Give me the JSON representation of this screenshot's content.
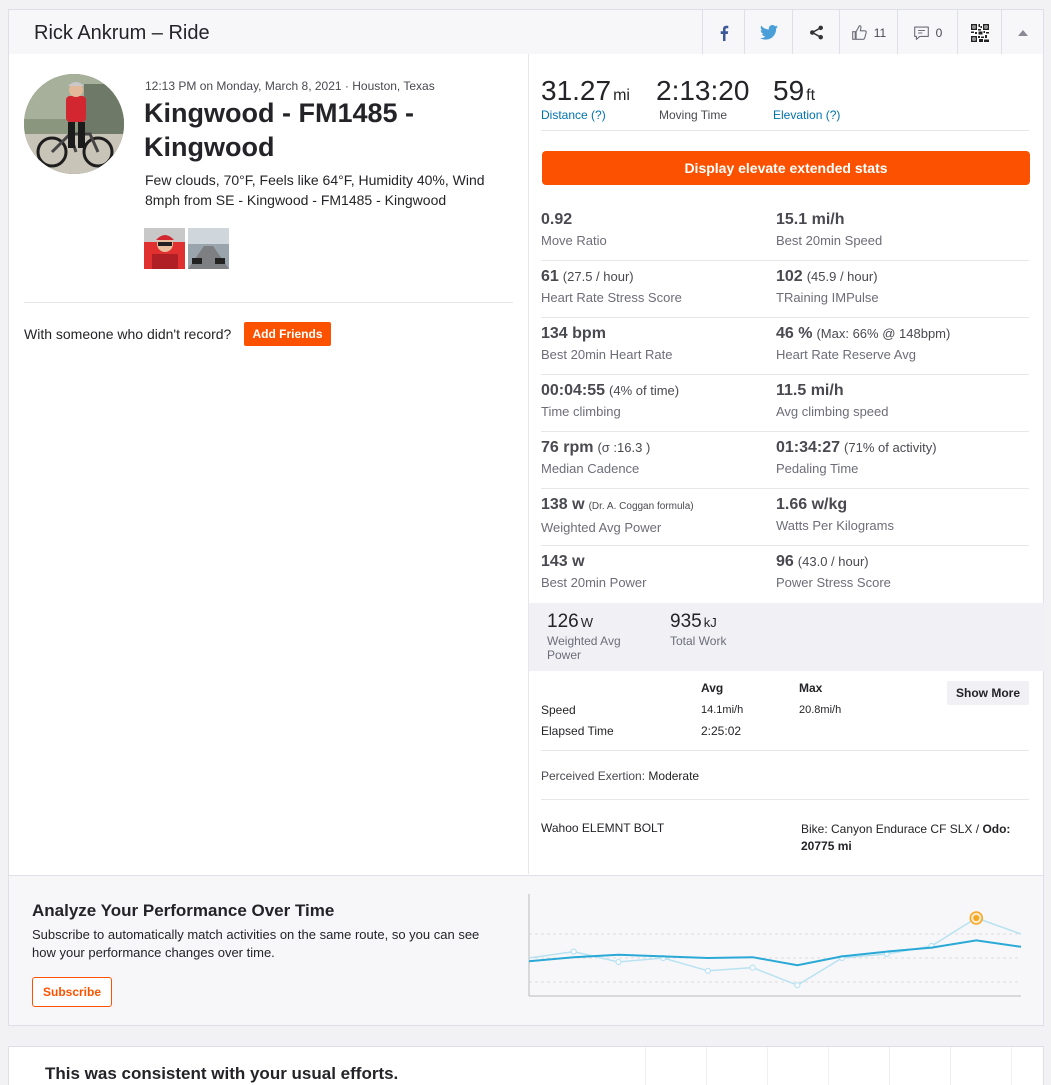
{
  "header": {
    "title": "Rick Ankrum – Ride",
    "kudos_count": "11",
    "comments_count": "0"
  },
  "activity": {
    "meta": "12:13 PM on Monday, March 8, 2021 · Houston, Texas",
    "title": "Kingwood - FM1485 - Kingwood",
    "description": "Few clouds, 70°F, Feels like 64°F, Humidity 40%, Wind 8mph from SE - Kingwood - FM1485 - Kingwood",
    "with_someone_text": "With someone who didn't record?",
    "add_friends_label": "Add Friends"
  },
  "summary": {
    "distance": {
      "value": "31.27",
      "unit": "mi",
      "label": "Distance (?)"
    },
    "moving_time": {
      "value": "2:13:20",
      "label": "Moving Time"
    },
    "elevation": {
      "value": "59",
      "unit": "ft",
      "label": "Elevation (?)"
    }
  },
  "elevate_button_label": "Display elevate extended stats",
  "extended_stats": [
    {
      "value": "0.92",
      "extra": "",
      "label": "Move Ratio"
    },
    {
      "value": "15.1 mi/h",
      "extra": "",
      "label": "Best 20min Speed"
    },
    {
      "value": "61",
      "extra": "(27.5 / hour)",
      "label": "Heart Rate Stress Score"
    },
    {
      "value": "102",
      "extra": "(45.9 / hour)",
      "label": "TRaining IMPulse"
    },
    {
      "value": "134 bpm",
      "extra": "",
      "label": "Best 20min Heart Rate"
    },
    {
      "value": "46 %",
      "extra": "(Max: 66% @ 148bpm)",
      "label": "Heart Rate Reserve Avg"
    },
    {
      "value": "00:04:55",
      "extra": "(4% of time)",
      "label": "Time climbing"
    },
    {
      "value": "11.5 mi/h",
      "extra": "",
      "label": "Avg climbing speed"
    },
    {
      "value": "76 rpm",
      "extra": "(σ :16.3 )",
      "label": "Median Cadence"
    },
    {
      "value": "01:34:27",
      "extra": "(71% of activity)",
      "label": "Pedaling Time"
    },
    {
      "value": "138 w",
      "extra": "(Dr. A. Coggan formula)",
      "label": "Weighted Avg Power"
    },
    {
      "value": "1.66 w/kg",
      "extra": "",
      "label": "Watts Per Kilograms"
    },
    {
      "value": "143 w",
      "extra": "",
      "label": "Best 20min Power"
    },
    {
      "value": "96",
      "extra": "(43.0 / hour)",
      "label": "Power Stress Score"
    }
  ],
  "power": {
    "weighted_avg": {
      "value": "126",
      "unit": "W",
      "label_line1": "Weighted Avg",
      "label_line2": "Power"
    },
    "total_work": {
      "value": "935",
      "unit": "kJ",
      "label": "Total Work"
    }
  },
  "table": {
    "col_avg": "Avg",
    "col_max": "Max",
    "show_more_label": "Show More",
    "rows": [
      {
        "label": "Speed",
        "avg": "14.1mi/h",
        "max": "20.8mi/h"
      },
      {
        "label": "Elapsed Time",
        "avg": "2:25:02",
        "max": ""
      }
    ]
  },
  "perceived": {
    "label": "Perceived Exertion:",
    "value": "Moderate"
  },
  "device": "Wahoo ELEMNT BOLT",
  "bike": {
    "prefix": "Bike: Canyon Endurace CF SLX / ",
    "odo_label": "Odo:",
    "odo_value": "20775 mi"
  },
  "promo": {
    "title": "Analyze Your Performance Over Time",
    "text": "Subscribe to automatically match activities on the same route, so you can see how your performance changes over time.",
    "subscribe_label": "Subscribe"
  },
  "promo_chart": {
    "series": [
      {
        "values": [
          0.64,
          0.59,
          0.56,
          0.58,
          0.6,
          0.59,
          0.69,
          0.58,
          0.52,
          0.47,
          0.38,
          0.46
        ]
      },
      {
        "values": [
          0.6,
          0.52,
          0.65,
          0.6,
          0.76,
          0.72,
          0.94,
          0.6,
          0.55,
          0.45,
          0.1,
          0.3
        ]
      }
    ],
    "highlight_index": 10,
    "colors": {
      "main": "#2aa9d6",
      "light": "#b9e2f0",
      "highlight": "#f5a623"
    }
  },
  "bottom": {
    "title": "This was consistent with your usual efforts."
  },
  "colors": {
    "brand": "#fc5200",
    "link": "#0073ad"
  }
}
